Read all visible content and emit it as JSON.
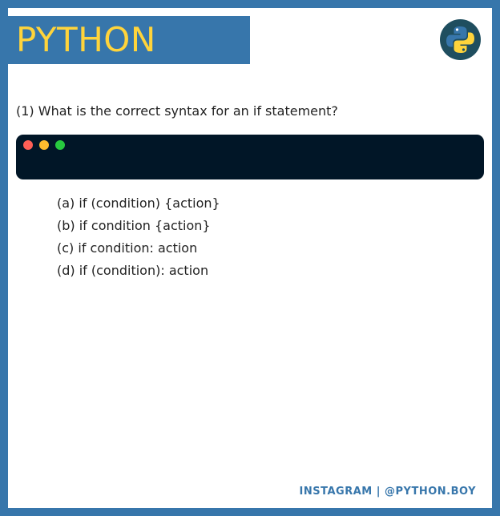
{
  "header": {
    "title": "PYTHON",
    "logo_icon": "python-logo-icon"
  },
  "question": {
    "text": "(1) What is the correct syntax for an if statement?"
  },
  "code_window": {
    "controls": [
      "close-dot",
      "minimize-dot",
      "maximize-dot"
    ],
    "code": ""
  },
  "options": [
    {
      "label": "(a) if (condition) {action}"
    },
    {
      "label": "(b) if condition {action}"
    },
    {
      "label": "(c) if condition: action"
    },
    {
      "label": "(d) if (condition): action"
    }
  ],
  "footer": {
    "text": "INSTAGRAM | @PYTHON.BOY"
  },
  "colors": {
    "frame_blue": "#3776ab",
    "title_yellow": "#ffd43b",
    "code_background": "#011627",
    "dot_red": "#ff5f56",
    "dot_yellow": "#ffbd2e",
    "dot_green": "#27c93f"
  }
}
